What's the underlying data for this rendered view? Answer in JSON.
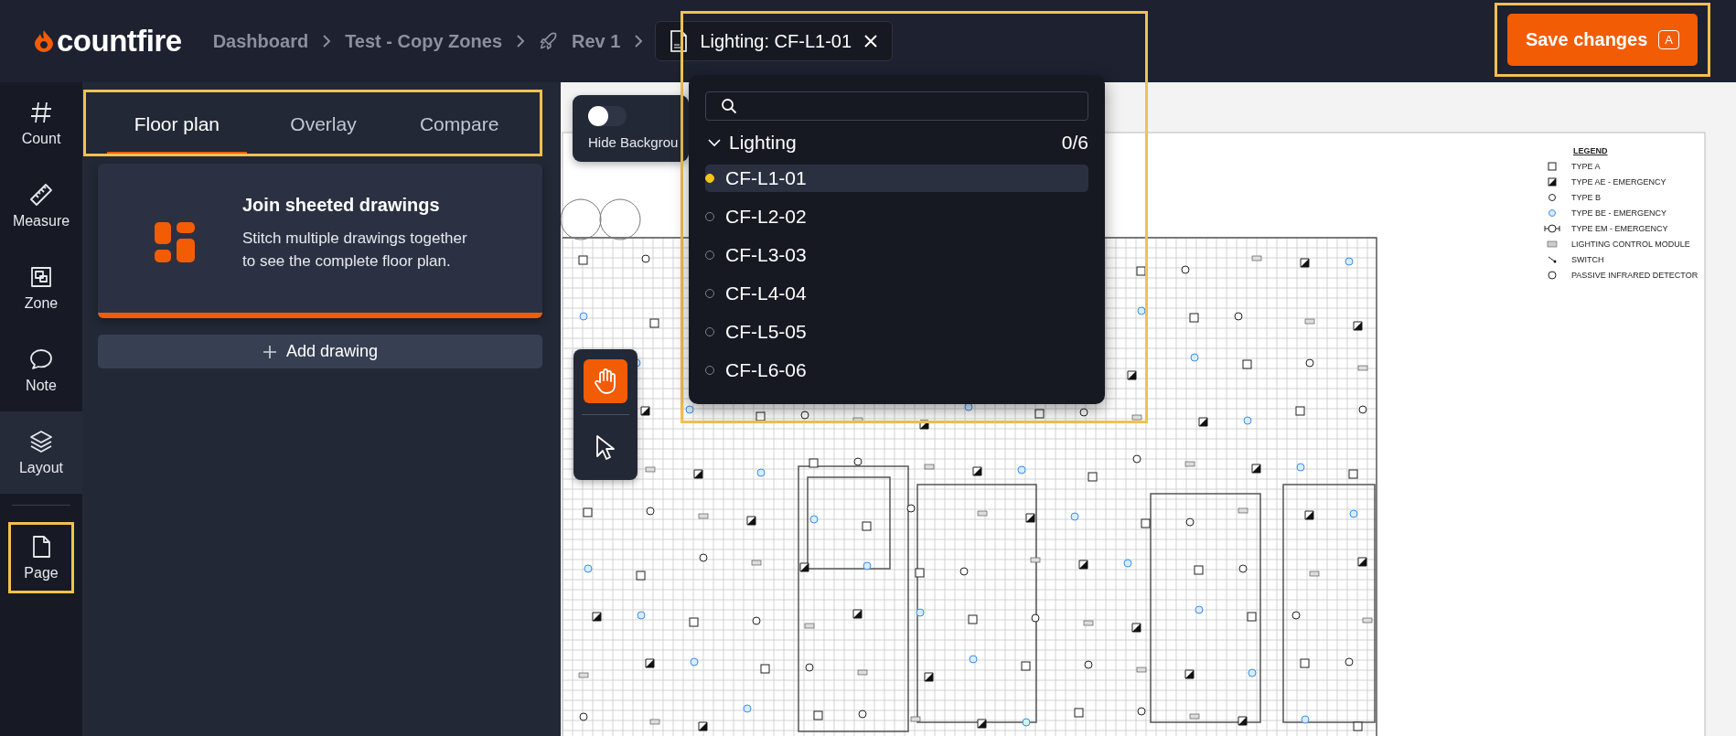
{
  "logo": {
    "label": "countfire"
  },
  "breadcrumbs": [
    {
      "label": "Dashboard",
      "kind": "plain"
    },
    {
      "label": "Test - Copy Zones",
      "kind": "plain"
    },
    {
      "label": "Rev 1",
      "kind": "revision"
    }
  ],
  "document_chip": {
    "label": "Lighting: CF-L1-01"
  },
  "save_button": {
    "label": "Save changes",
    "shortcut": "A",
    "highlighted": true
  },
  "rail": {
    "tools": [
      {
        "label": "Count",
        "kind": "hash",
        "selected": false
      },
      {
        "label": "Measure",
        "kind": "ruler",
        "selected": false
      },
      {
        "label": "Zone",
        "kind": "zone",
        "selected": false
      },
      {
        "label": "Note",
        "kind": "note",
        "selected": false
      },
      {
        "label": "Layout",
        "kind": "layers",
        "selected": true
      }
    ],
    "bottom": [
      {
        "label": "Page",
        "kind": "page",
        "selected": false,
        "highlighted": true
      }
    ]
  },
  "panel": {
    "tabs_highlighted": true,
    "tabs": [
      {
        "label": "Floor plan",
        "selected": true
      },
      {
        "label": "Overlay",
        "selected": false
      },
      {
        "label": "Compare",
        "selected": false
      }
    ],
    "card": {
      "title": "Join sheeted drawings",
      "text": "Stitch multiple drawings together to see the complete floor plan."
    },
    "add_button": {
      "label": "Add drawing"
    }
  },
  "canvas": {
    "toggle": {
      "label": "Hide Backgrou",
      "on": false
    },
    "tools": [
      {
        "kind": "hand",
        "selected": true
      },
      {
        "kind": "pointer",
        "selected": false
      }
    ],
    "legend": {
      "title": "LEGEND",
      "items": [
        {
          "kind": "type-a",
          "label": "TYPE A"
        },
        {
          "kind": "type-ae",
          "label": "TYPE AE - EMERGENCY"
        },
        {
          "kind": "type-b",
          "label": "TYPE B"
        },
        {
          "kind": "type-be",
          "label": "TYPE BE - EMERGENCY"
        },
        {
          "kind": "type-em",
          "label": "TYPE EM - EMERGENCY"
        },
        {
          "kind": "module",
          "label": "LIGHTING CONTROL MODULE"
        },
        {
          "kind": "switch",
          "label": "SWITCH"
        },
        {
          "kind": "pir",
          "label": "PASSIVE INFRARED DETECTOR"
        }
      ]
    }
  },
  "dropdown": {
    "highlighted": true,
    "group": {
      "label": "Lighting",
      "count": "0/6",
      "expanded": true,
      "items": [
        {
          "label": "CF-L1-01",
          "selected": true
        },
        {
          "label": "CF-L2-02",
          "selected": false
        },
        {
          "label": "CF-L3-03",
          "selected": false
        },
        {
          "label": "CF-L4-04",
          "selected": false
        },
        {
          "label": "CF-L5-05",
          "selected": false
        },
        {
          "label": "CF-L6-06",
          "selected": false
        }
      ]
    }
  }
}
